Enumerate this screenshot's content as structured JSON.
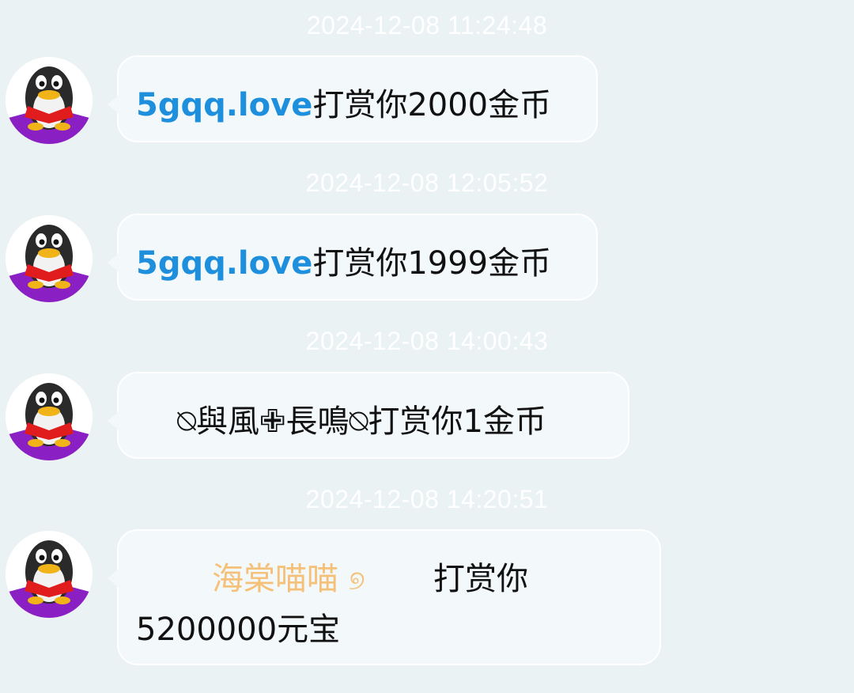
{
  "messages": [
    {
      "timestamp": "2024-12-08 11:24:48",
      "sender": "5gqq.love",
      "action": "打赏你2000金币"
    },
    {
      "timestamp": "2024-12-08 12:05:52",
      "sender": "5gqq.love",
      "action": "打赏你1999金币"
    },
    {
      "timestamp": "2024-12-08 14:00:43",
      "sender": "⍉與風✙長鳴⍉",
      "action": "打赏你1金币"
    },
    {
      "timestamp": "2024-12-08 14:20:51",
      "sender": "海棠喵喵",
      "sender_symbol": "୭",
      "action": "打赏你",
      "amount": "5200000元宝"
    }
  ],
  "colors": {
    "background": "#eaf2f4",
    "bubble": "#f3f8fa",
    "link": "#1d8fdc",
    "orange_name": "#f5c078",
    "timestamp": "#ffffff"
  },
  "icons": {
    "avatar": "qq-penguin-avatar-icon"
  }
}
